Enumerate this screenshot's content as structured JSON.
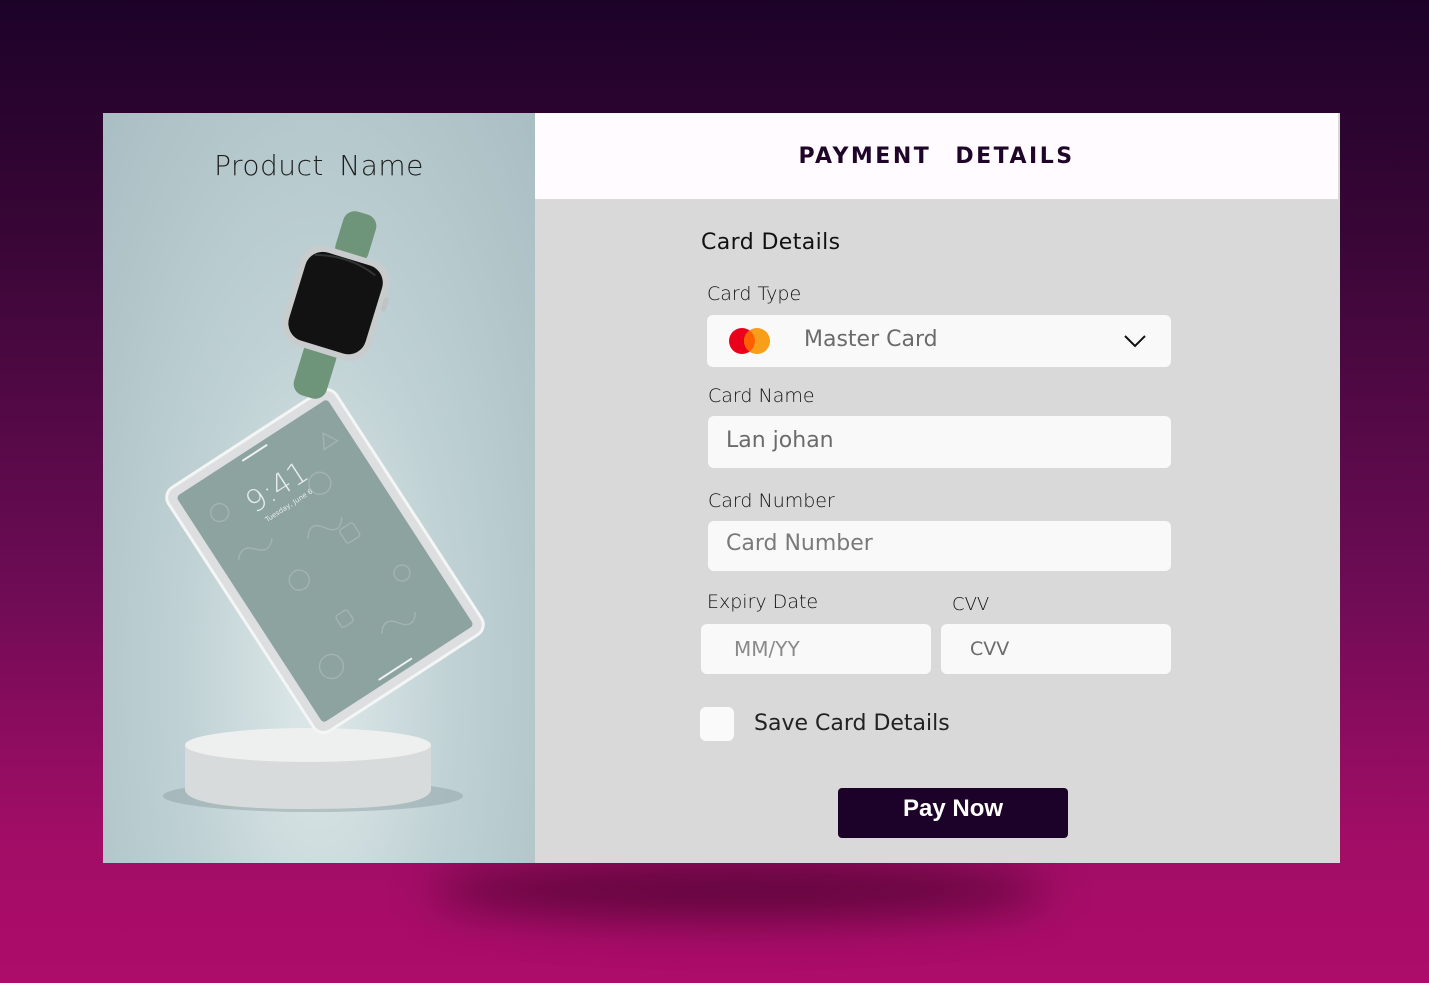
{
  "product": {
    "name": "Product  Name"
  },
  "header": {
    "title": "PAYMENT  DETAILS"
  },
  "form": {
    "section_title": "Card Details",
    "card_type": {
      "label": "Card Type",
      "value": "Master Card",
      "icon": "mastercard-icon"
    },
    "card_name": {
      "label": "Card Name",
      "value": "Lan johan"
    },
    "card_number": {
      "label": "Card Number",
      "placeholder": "Card Number"
    },
    "expiry": {
      "label": "Expiry Date",
      "placeholder": "MM/YY"
    },
    "cvv": {
      "label": "CVV",
      "placeholder": "CVV"
    },
    "save_card": {
      "label": "Save Card Details",
      "checked": false
    },
    "pay_button": "Pay Now"
  },
  "device_screen": {
    "time": "9:41",
    "date": "Tuesday, June 6"
  },
  "colors": {
    "accent": "#1c0229",
    "header_bg": "#fffbff",
    "panel_bg": "#d9d9d9",
    "mastercard_red": "#eb001b",
    "mastercard_orange": "#f79e1b"
  }
}
